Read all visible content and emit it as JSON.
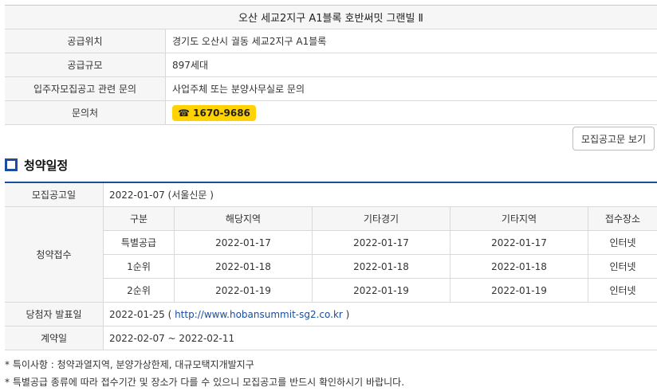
{
  "info": {
    "title": "오산 세교2지구 A1블록 호반써밋 그랜빌 Ⅱ",
    "rows": [
      {
        "label": "공급위치",
        "value": "경기도 오산시 궐동 세교2지구 A1블록"
      },
      {
        "label": "공급규모",
        "value": "897세대"
      },
      {
        "label": "입주자모집공고 관련 문의",
        "value": "사업주체 또는 분양사무실로 문의"
      },
      {
        "label": "문의처",
        "value": "☎ 1670-9686"
      }
    ]
  },
  "notice_button": "모집공고문 보기",
  "schedule": {
    "title": "청약일정",
    "announcement": {
      "label": "모집공고일",
      "value": "2022-01-07 (서울신문 )"
    },
    "reception": {
      "label": "청약접수",
      "headers": [
        "구분",
        "해당지역",
        "기타경기",
        "기타지역",
        "접수장소"
      ],
      "rows": [
        [
          "특별공급",
          "2022-01-17",
          "2022-01-17",
          "2022-01-17",
          "인터넷"
        ],
        [
          "1순위",
          "2022-01-18",
          "2022-01-18",
          "2022-01-18",
          "인터넷"
        ],
        [
          "2순위",
          "2022-01-19",
          "2022-01-19",
          "2022-01-19",
          "인터넷"
        ]
      ]
    },
    "winners": {
      "label": "당첨자 발표일",
      "date": "2022-01-25",
      "open": " ( ",
      "url": "http://www.hobansummit-sg2.co.kr",
      "close": " )"
    },
    "contract": {
      "label": "계약일",
      "value": "2022-02-07 ~ 2022-02-11"
    }
  },
  "notes": [
    "* 특이사항 : 청약과열지역, 분양가상한제, 대규모택지개발지구",
    "* 특별공급 종류에 따라 접수기간 및 장소가 다를 수 있으니 모집공고를 반드시 확인하시기 바랍니다."
  ]
}
